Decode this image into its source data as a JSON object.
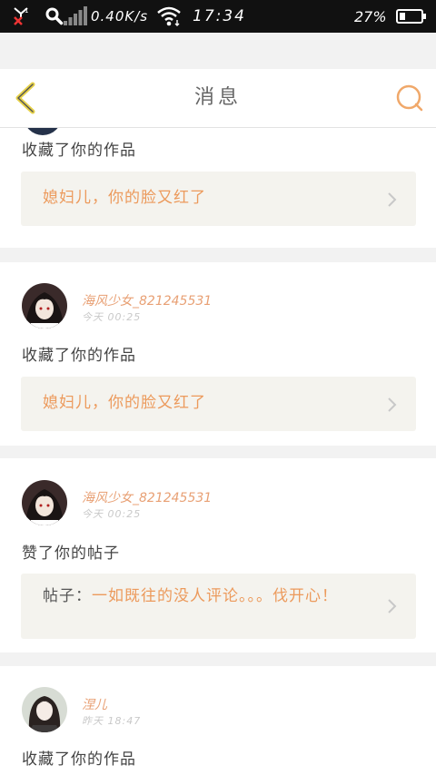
{
  "status_bar": {
    "net_speed": "0.40K/s",
    "time": "17:34",
    "battery_percent": "27%",
    "battery_level": 0.27
  },
  "nav": {
    "title": "消息"
  },
  "colors": {
    "accent": "#ec9a5c",
    "back_arrow": "#e7d24a",
    "search_icon": "#f0a86a"
  },
  "feed": [
    {
      "username": "",
      "time": "",
      "action": "收藏了你的作品",
      "quote_prefix": "",
      "quote": "媳妇儿，你的脸又红了"
    },
    {
      "username": "海风少女_821245531",
      "time": "今天 00:25",
      "action": "收藏了你的作品",
      "quote_prefix": "",
      "quote": "媳妇儿，你的脸又红了"
    },
    {
      "username": "海风少女_821245531",
      "time": "今天 00:25",
      "action": "赞了你的帖子",
      "quote_prefix": "帖子：",
      "quote": "一如既往的没人评论。。。伐开心！"
    },
    {
      "username": "涅儿",
      "time": "昨天 18:47",
      "action": "收藏了你的作品",
      "quote_prefix": "",
      "quote": ""
    }
  ]
}
